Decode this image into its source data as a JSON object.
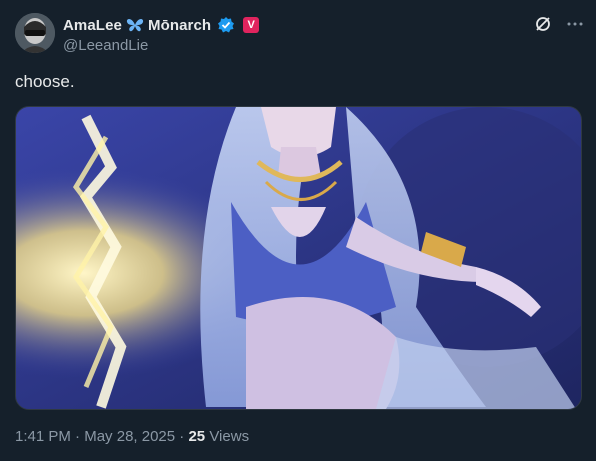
{
  "author": {
    "display_name_first": "AmaLee",
    "display_name_second": "Mōnarch",
    "handle": "@LeeandLie",
    "badge_letter": "V",
    "icons": [
      "butterfly-icon",
      "verified-icon",
      "v-badge"
    ]
  },
  "header_actions": {
    "icons": [
      "grok-icon",
      "more-icon"
    ]
  },
  "tweet": {
    "text": "choose."
  },
  "meta": {
    "time": "1:41 PM",
    "separator1": " · ",
    "date": "May 28, 2025",
    "separator2": " · ",
    "views_count": "25",
    "views_label": " Views"
  },
  "colors": {
    "background": "#15202b",
    "text_primary": "#e7e9ea",
    "text_secondary": "#8b98a5",
    "verified_blue": "#1d9bf0",
    "badge_pink": "#e0245e"
  }
}
